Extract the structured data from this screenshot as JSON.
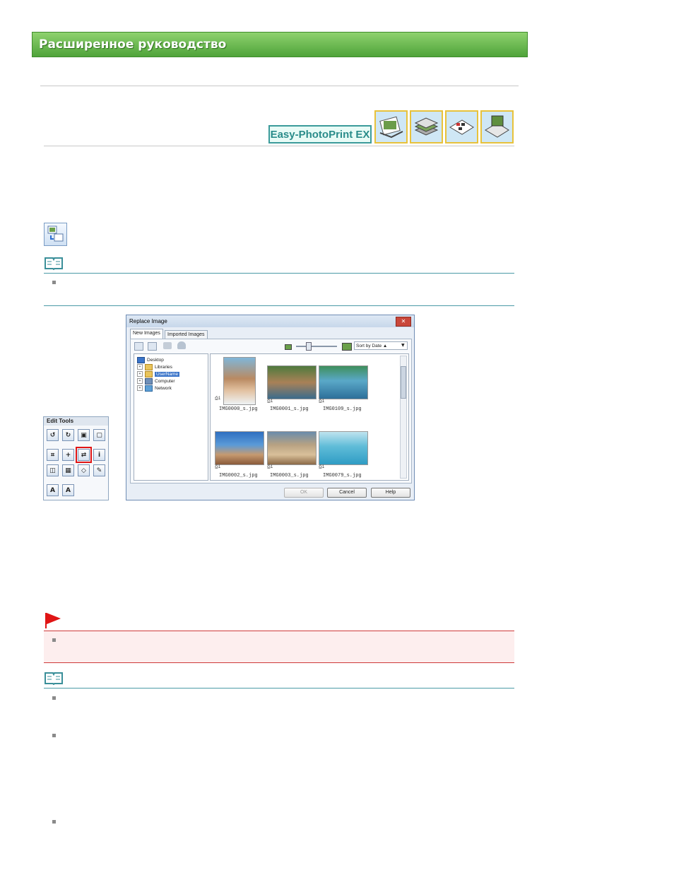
{
  "header": {
    "title": "Расширенное руководство"
  },
  "product": {
    "logo_text": "Easy-PhotoPrint EX"
  },
  "mode_buttons": [
    "album-mode-icon",
    "stack-photos-icon",
    "calendar-mode-icon",
    "layout-print-icon"
  ],
  "dialog": {
    "title": "Replace Image",
    "close_symbol": "✕",
    "tabs": [
      "New Images",
      "Imported Images"
    ],
    "sort_label": "Sort by Date ▲",
    "tree": [
      {
        "label": "Desktop",
        "level": 0
      },
      {
        "label": "Libraries",
        "level": 1
      },
      {
        "label": "UserName",
        "level": 1,
        "selected": true
      },
      {
        "label": "Computer",
        "level": 1
      },
      {
        "label": "Network",
        "level": 1
      }
    ],
    "thumbnails": [
      {
        "name": "IMG0000_s.jpg",
        "badge": "1"
      },
      {
        "name": "IMG0001_s.jpg",
        "badge": "1"
      },
      {
        "name": "IMG0109_s.jpg",
        "badge": "1"
      },
      {
        "name": "IMG0002_s.jpg",
        "badge": "1"
      },
      {
        "name": "IMG0003_s.jpg",
        "badge": "1"
      },
      {
        "name": "IMG0079_s.jpg",
        "badge": "1"
      }
    ],
    "buttons": {
      "ok": "OK",
      "cancel": "Cancel",
      "help": "Help"
    }
  },
  "edit_tools": {
    "title": "Edit Tools",
    "text_button_a": "A",
    "text_button_a2": "A"
  },
  "colors": {
    "banner": "#5fb245",
    "accent_teal": "#4a9aa6",
    "important_red": "#cf3a3a",
    "important_bg": "#fdeeee"
  }
}
